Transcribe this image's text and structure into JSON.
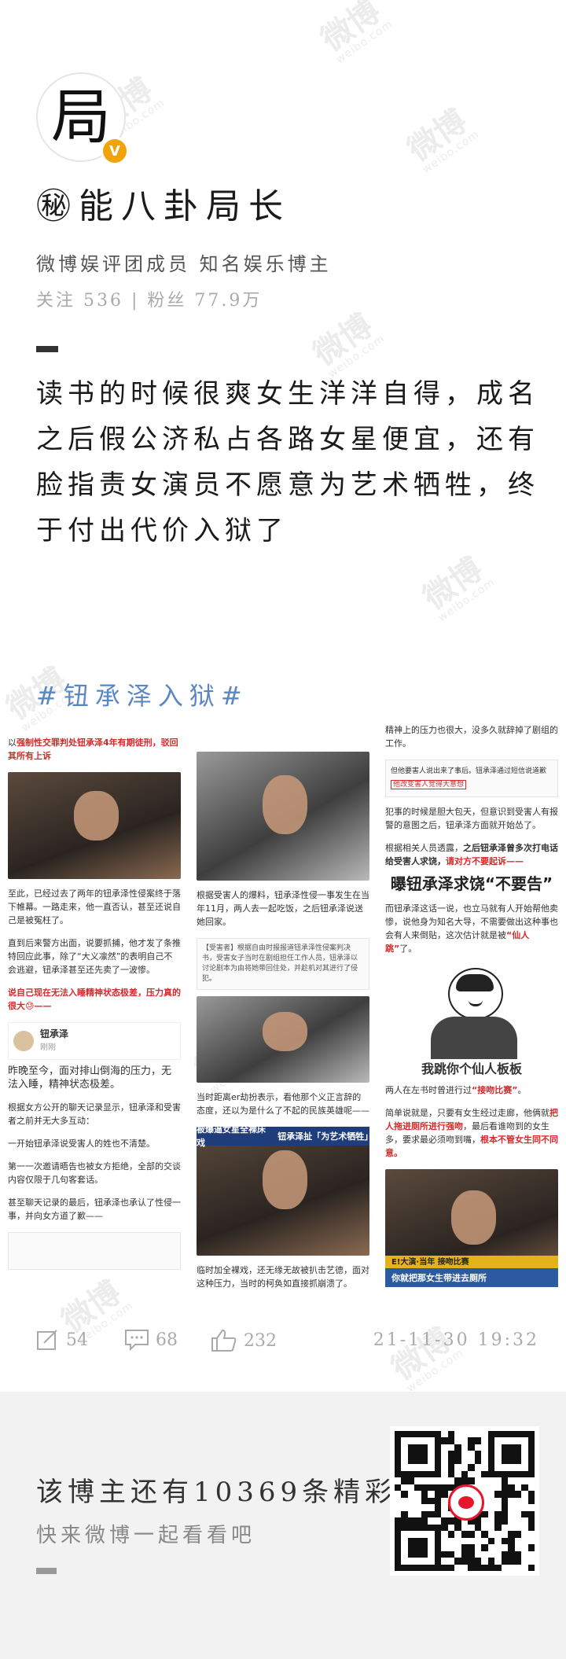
{
  "profile": {
    "avatar_text": "局",
    "verified_badge": "V",
    "name": "㊙能八卦局长",
    "bio": "微博娱评团成员 知名娱乐博主",
    "stats": "关注 536 | 粉丝 77.9万"
  },
  "post": {
    "text": "读书的时候很爽女生洋洋自得，成名之后假公济私占各路女星便宜，还有脸指责女演员不愿意为艺术牺牲，终于付出代价入狱了",
    "hashtag": "#钮承泽入狱#"
  },
  "article": {
    "col1": {
      "p1_pre": "以",
      "p1_red": "强制性交罪判处钮承泽4年有期徒刑，驳回其所有上诉",
      "p2": "至此，已经过去了两年的钮承泽性侵案终于落下帷幕。一路走来，他一直否认，甚至还说自己是被冤枉了。",
      "p3": "直到后来警方出面，说要抓捕，他才发了条推特回应此事，除了“大义凛然”的表明自己不会逃避，钮承泽甚至还先卖了一波惨。",
      "p4_red": "说自己现在无法入睡精神状态极差，压力真的很大😓——",
      "weibo_name": "钮承泽",
      "weibo_time": "刚刚",
      "weibo_quote": "昨晚至今，面对排山倒海的压力，无法入睡，精神状态极差。",
      "p5": "根据女方公开的聊天记录显示，钮承泽和受害者之前并无大多互动：",
      "p6": "一开始钮承泽说受害人的姓也不清楚。",
      "p7": "第一一次邀请晤告也被女方拒绝，全部的交谈内容仅限于几句客套话。",
      "p8": "甚至聊天记录的最后，钮承泽也承认了性侵一事，并向女方道了歉——"
    },
    "col2": {
      "p1": "根据受害人的爆料，钮承泽性侵一事发生在当年11月，两人去一起吃饭，之后钮承泽说送她回家。",
      "doc_text": "【受害者】根据自由时报报道钮承泽性侵案判决书，受害女子当时在剧组担任工作人员，钮承泽以讨论剧本为由将她带回住处，并趁机对其进行了侵犯。",
      "p2": "当时距离er劫扮表示，看他那个义正言辞的态度，还以为是什么了不起的民族英雄呢——",
      "banner_left": "被爆逼女星全裸床戏",
      "banner_right": "钮承泽扯「为艺术牺牲」",
      "p3": "临时加全裸戏，还无缘无故被扒击艺德，面对这种压力，当时的柯奂如直接抓崩溃了。"
    },
    "col3": {
      "p1": "精神上的压力也很大，没多久就辞掉了剧组的工作。",
      "note": "但他要害人说出来了事后。钮承泽通过短信说道歉",
      "note_highlight": "他改变害人觉得大意想",
      "p2": "犯事的时候是胆大包天，但意识到受害人有报警的意图之后，钮承泽方面就开始怂了。",
      "p3_pre": "根据相关人员透露，",
      "p3_bold": "之后钮承泽曾多次打电话给受害人求饶，",
      "p3_red": "请对方不要起诉——",
      "headline_pre": "曝钮承泽求饶",
      "headline_quote": "“不要告”",
      "p4_pre": "而钮承泽这话一说，也立马就有人开始帮他卖惨，说他身为知名大导，不需要做出这种事也会有人来倒贴，这次估计就是被",
      "p4_red": "“仙人跳”",
      "p4_post": "了。",
      "meme_caption": "我跳你个仙人板板",
      "p5_pre": "两人在左书时曾进行过",
      "p5_red": "“接吻比赛”",
      "p5_post": "。",
      "p6_pre": "简单说就是，只要有女生经过走廊，他俩就",
      "p6_red": "把人拖进厕所进行强吻",
      "p6_mid": "，最后看谁吻到的女生多，要求最必须吻到嘴，",
      "p6_red2": "根本不管女生同不同意。",
      "tv_top": "E!大演·当年",
      "tv_banner": "你就把那女生带进去厕所",
      "tv_tag": "接吻比赛"
    }
  },
  "actions": {
    "repost_count": "54",
    "comment_count": "68",
    "like_count": "232",
    "timestamp": "21-11-30 19:32"
  },
  "footer": {
    "line1": "该博主还有10369条精彩微博",
    "line2": "快来微博一起看看吧"
  },
  "colors": {
    "hashtag": "#5b88c5",
    "accent_red": "#d32b2b",
    "verified": "#f0a30a",
    "weibo_red": "#e6162d"
  },
  "watermark": {
    "brand": "微博",
    "domain": "weibo.com"
  }
}
